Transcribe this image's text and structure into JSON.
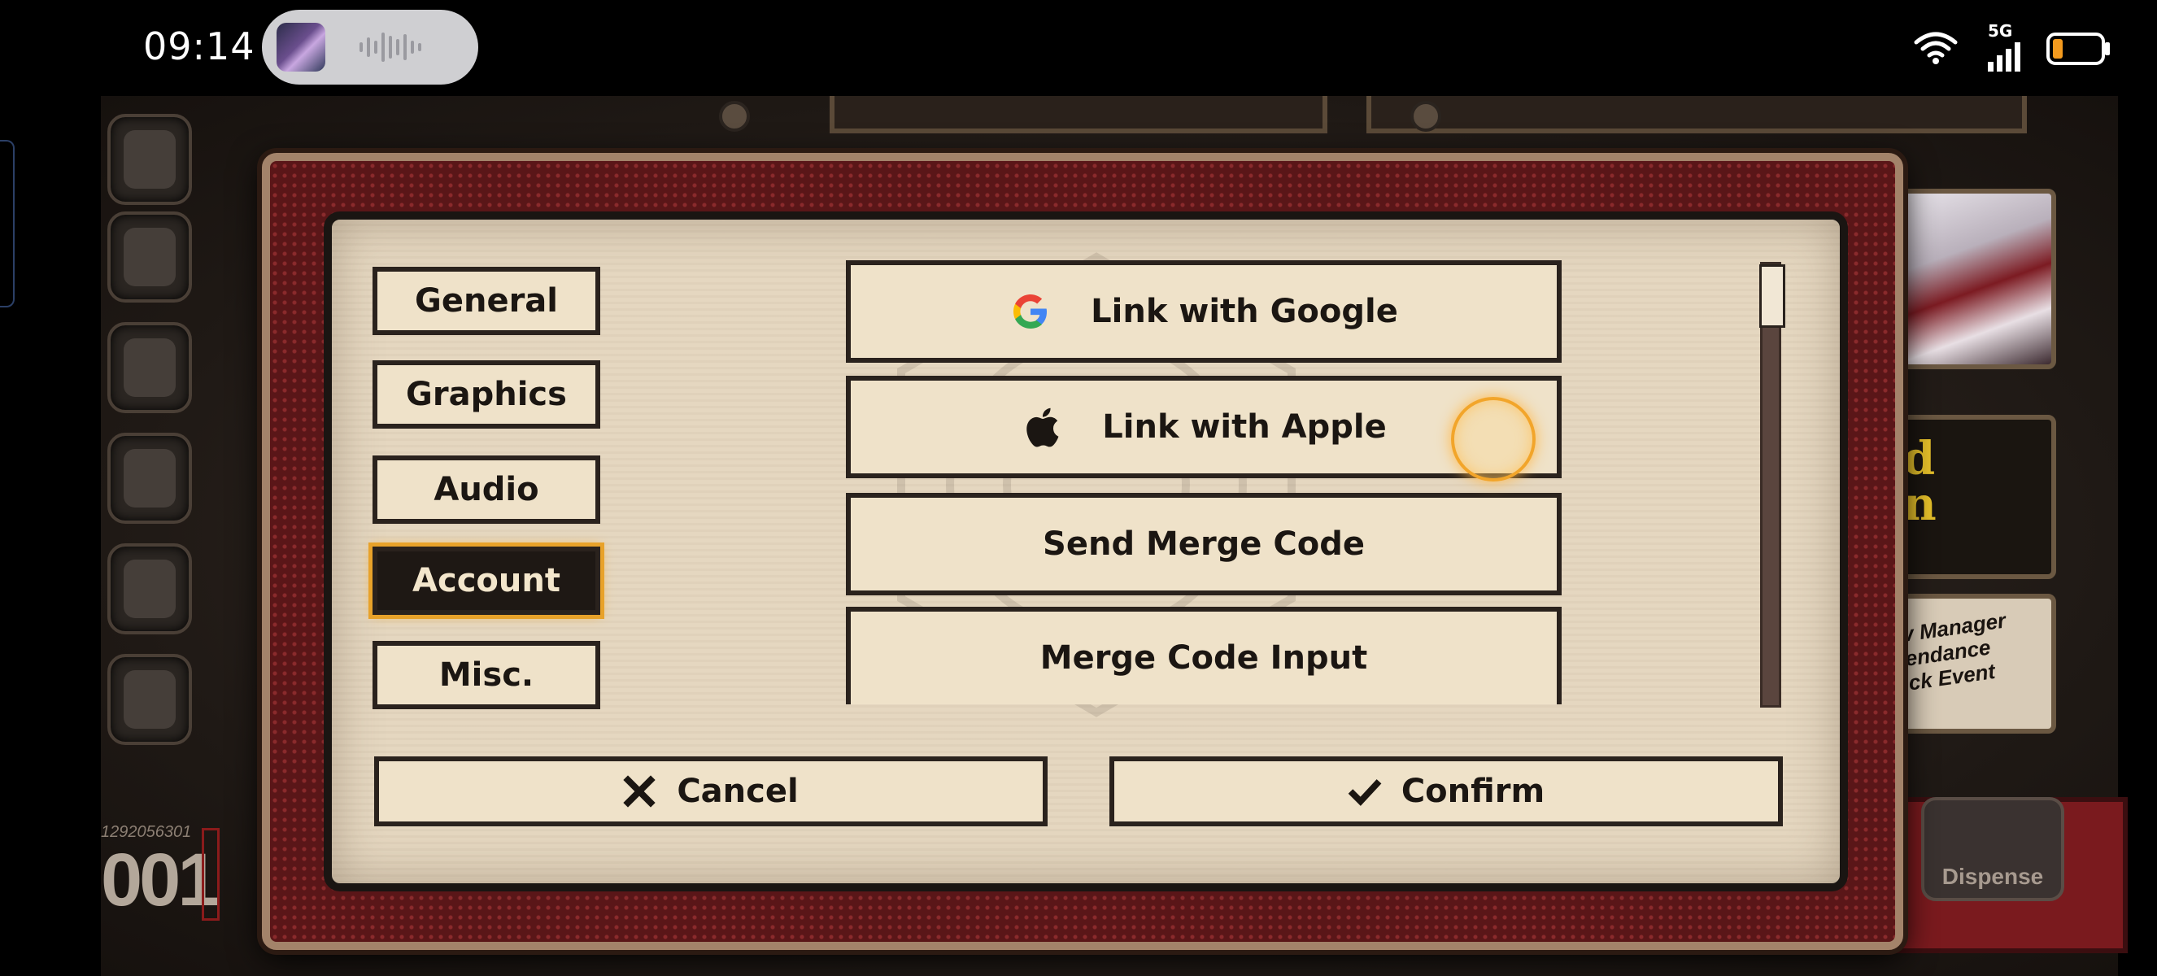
{
  "status_bar": {
    "time": "09:14",
    "network": "5G",
    "icons": [
      "wifi-icon",
      "cellular-signal-icon",
      "battery-low-icon"
    ]
  },
  "settings": {
    "tabs": [
      {
        "label": "General",
        "active": false
      },
      {
        "label": "Graphics",
        "active": false
      },
      {
        "label": "Audio",
        "active": false
      },
      {
        "label": "Account",
        "active": true
      },
      {
        "label": "Misc.",
        "active": false
      }
    ],
    "account_options": [
      {
        "label": "Link with Google",
        "icon": "google-icon"
      },
      {
        "label": "Link with Apple",
        "icon": "apple-icon"
      },
      {
        "label": "Send Merge Code",
        "icon": ""
      },
      {
        "label": "Merge Code Input",
        "icon": ""
      }
    ],
    "cancel_label": "Cancel",
    "confirm_label": "Confirm"
  },
  "background": {
    "player_serial": "1292056301",
    "player_number": "001",
    "banner_text": "d\nn",
    "event_text": "v Manager\nendance\nck Event",
    "dispense_label": "Dispense"
  },
  "colors": {
    "dialog_frame": "#5a1618",
    "panel_bg": "#e5d7c0",
    "active_tab_glow": "#e8a22a",
    "button_bg": "#efe2c9"
  }
}
